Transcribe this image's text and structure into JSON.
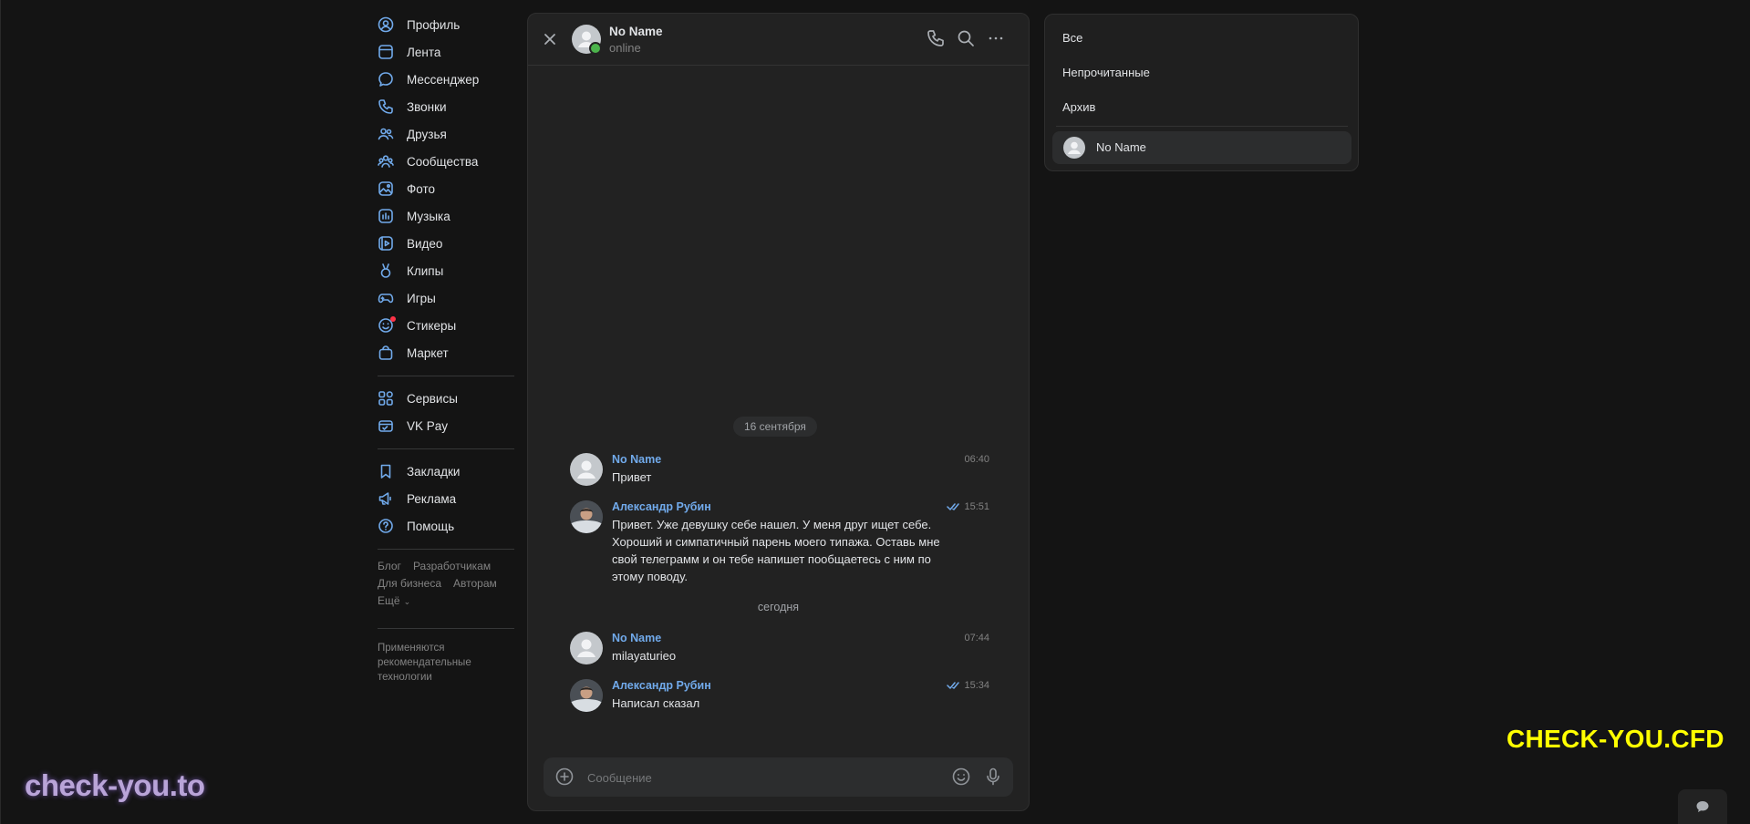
{
  "nav": {
    "items": [
      {
        "label": "Профиль",
        "icon": "profile-icon"
      },
      {
        "label": "Лента",
        "icon": "feed-icon"
      },
      {
        "label": "Мессенджер",
        "icon": "messenger-icon"
      },
      {
        "label": "Звонки",
        "icon": "calls-icon"
      },
      {
        "label": "Друзья",
        "icon": "friends-icon"
      },
      {
        "label": "Сообщества",
        "icon": "communities-icon"
      },
      {
        "label": "Фото",
        "icon": "photo-icon"
      },
      {
        "label": "Музыка",
        "icon": "music-icon"
      },
      {
        "label": "Видео",
        "icon": "video-icon"
      },
      {
        "label": "Клипы",
        "icon": "clips-icon"
      },
      {
        "label": "Игры",
        "icon": "games-icon"
      },
      {
        "label": "Стикеры",
        "icon": "stickers-icon"
      },
      {
        "label": "Маркет",
        "icon": "market-icon"
      }
    ],
    "secondary": [
      {
        "label": "Сервисы",
        "icon": "services-icon"
      },
      {
        "label": "VK Pay",
        "icon": "vkpay-icon"
      }
    ],
    "tertiary": [
      {
        "label": "Закладки",
        "icon": "bookmarks-icon"
      },
      {
        "label": "Реклама",
        "icon": "ads-icon"
      },
      {
        "label": "Помощь",
        "icon": "help-icon"
      }
    ],
    "footer_links": [
      "Блог",
      "Разработчикам",
      "Для бизнеса",
      "Авторам",
      "Ещё"
    ],
    "footer_note": "Применяются рекомендательные технологии"
  },
  "chat": {
    "name": "No Name",
    "status": "online",
    "date_separator_1": "16 сентября",
    "date_separator_2": "сегодня",
    "messages": [
      {
        "author": "No Name",
        "time": "06:40",
        "text": "Привет"
      },
      {
        "author": "Александр Рубин",
        "time": "15:51",
        "text": "Привет. Уже девушку себе нашел. У меня друг ищет себе. Хороший и симпатичный парень моего типажа. Оставь мне свой телеграмм и он тебе напишет пообщаетесь с ним по этому поводу."
      },
      {
        "author": "No Name",
        "time": "07:44",
        "text": "milayaturieo"
      },
      {
        "author": "Александр Рубин",
        "time": "15:34",
        "text": "Написал сказал"
      }
    ],
    "composer_placeholder": "Сообщение"
  },
  "folders": {
    "items": [
      "Все",
      "Непрочитанные",
      "Архив"
    ],
    "conversation": "No Name"
  },
  "watermarks": {
    "left": "check-you.to",
    "right": "CHECK-YOU.CFD"
  },
  "colors": {
    "accent": "#71aaeb",
    "background": "#141414",
    "panel": "#222222",
    "online": "#4bb34b",
    "badge": "#ff3347",
    "watermark_right": "#ffff00"
  }
}
